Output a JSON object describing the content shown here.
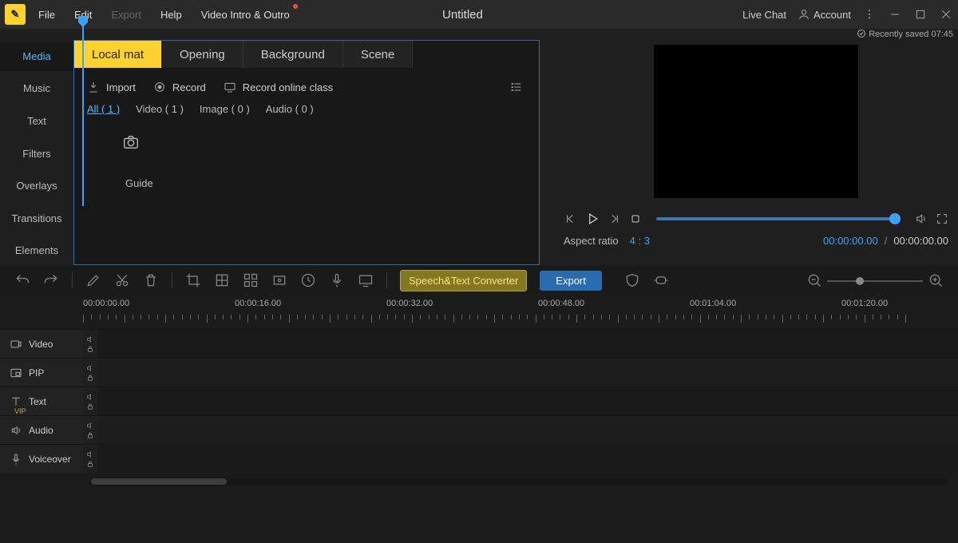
{
  "titlebar": {
    "menus": [
      "File",
      "Edit",
      "Export",
      "Help",
      "Video Intro & Outro"
    ],
    "export_disabled": true,
    "title": "Untitled",
    "livechat": "Live Chat",
    "account": "Account"
  },
  "saved_status": "Recently saved 07:45",
  "leftnav": [
    "Media",
    "Music",
    "Text",
    "Filters",
    "Overlays",
    "Transitions",
    "Elements"
  ],
  "media_tabs": [
    "Local mat",
    "Opening",
    "Background",
    "Scene"
  ],
  "media_actions": {
    "import": "Import",
    "record": "Record",
    "record_online": "Record online class"
  },
  "media_filters": {
    "all": "All ( 1 )",
    "video": "Video ( 1 )",
    "image": "Image ( 0 )",
    "audio": "Audio ( 0 )"
  },
  "guide_label": "Guide",
  "preview": {
    "aspect_label": "Aspect ratio",
    "aspect_value": "4 : 3",
    "current_time": "00:00:00.00",
    "total_time": "00:00:00.00"
  },
  "toolbar": {
    "speech": "Speech&Text Converter",
    "export": "Export"
  },
  "ruler_labels": [
    "00:00:00.00",
    "00:00:16.00",
    "00:00:32.00",
    "00:00:48.00",
    "00:01:04.00",
    "00:01:20.00"
  ],
  "tracks": [
    {
      "name": "Video",
      "vip": false
    },
    {
      "name": "PIP",
      "vip": false
    },
    {
      "name": "Text",
      "vip": true
    },
    {
      "name": "Audio",
      "vip": false
    },
    {
      "name": "Voiceover",
      "vip": false
    }
  ]
}
